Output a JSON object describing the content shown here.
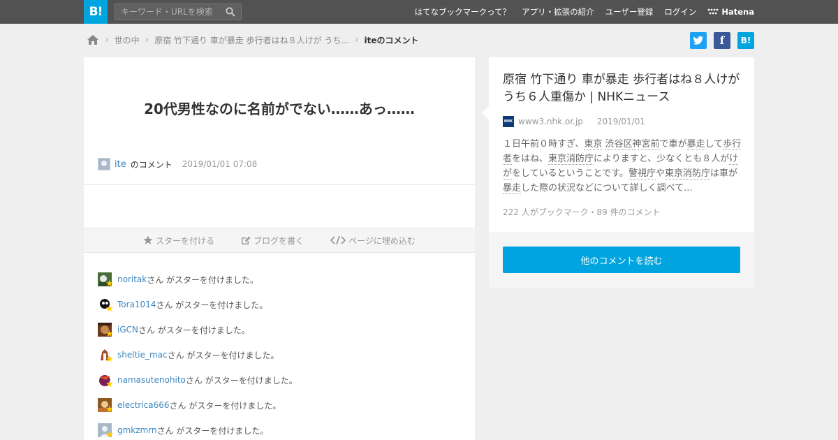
{
  "header": {
    "logo": "B!",
    "search_placeholder": "キーワード・URLを検索",
    "nav": [
      "はてなブックマークって？",
      "アプリ・拡張の紹介",
      "ユーザー登録",
      "ログイン"
    ],
    "brand": "Hatena",
    "bg_color": "#525252",
    "accent": "#00a4de"
  },
  "breadcrumb": {
    "home_icon": "home-icon",
    "items": [
      "世の中",
      "原宿 竹下通り 車が暴走 歩行者はね８人けが うち...",
      "iteのコメント"
    ]
  },
  "share": {
    "twitter": "t",
    "facebook": "f",
    "hatena": "B!"
  },
  "comment": {
    "text": "20代男性なのに名前がでない……あっ……",
    "user": "ite",
    "suffix": "のコメント",
    "datetime": "2019/01/01 07:08"
  },
  "actions": [
    "スターを付ける",
    "ブログを書く",
    "ページに埋め込む"
  ],
  "stars": {
    "suffix": "さん がスターを付けました。",
    "users": [
      "noritak",
      "Tora1014",
      "iGCN",
      "sheltie_mac",
      "namasutenohito",
      "electrica666",
      "gmkzmrn"
    ]
  },
  "article": {
    "title": "原宿 竹下通り 車が暴走 歩行者はね８人けが うち６人重傷か | NHKニュース",
    "source_icon": "NHK",
    "domain": "www3.nhk.or.jp",
    "date": "2019/01/01",
    "excerpt_parts": [
      {
        "t": "１日午前０時すぎ、"
      },
      {
        "t": "東京",
        "u": true
      },
      {
        "t": " "
      },
      {
        "t": "渋谷区",
        "u": true
      },
      {
        "t": "神宮前",
        "u": true
      },
      {
        "t": "で車が"
      },
      {
        "t": "暴走",
        "u": true
      },
      {
        "t": "して"
      },
      {
        "t": "歩行者",
        "u": true
      },
      {
        "t": "をはね、"
      },
      {
        "t": "東京消防庁",
        "u": true
      },
      {
        "t": "によりますと、少なくとも８人が"
      },
      {
        "t": "けが",
        "u": true
      },
      {
        "t": "をしているということです。"
      },
      {
        "t": "警視庁",
        "u": true
      },
      {
        "t": "や"
      },
      {
        "t": "東京消防庁",
        "u": true
      },
      {
        "t": "は車が"
      },
      {
        "t": "暴走",
        "u": true
      },
      {
        "t": "した際の状況などについて詳しく調べて..."
      }
    ],
    "counts": "222 人がブックマーク・89 件のコメント",
    "read_more": "他のコメントを読む"
  }
}
